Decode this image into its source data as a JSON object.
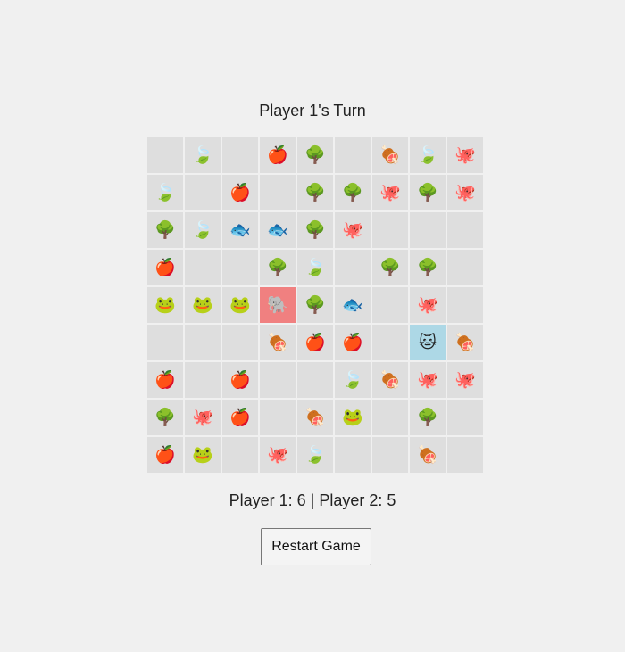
{
  "status": {
    "turn_text": "Player 1's Turn",
    "score_text": "Player 1: 6 | Player 2: 5"
  },
  "controls": {
    "restart_label": "Restart Game"
  },
  "board": {
    "cols": 9,
    "rows": 9,
    "colors": {
      "cell": "#dedede",
      "player1_selected": "#f08080",
      "player2_selected": "#add8e6"
    },
    "pieces": {
      "apple": "🍎",
      "tree": "🌳",
      "leaf": "🍃",
      "meat": "🍖",
      "octopus": "🐙",
      "fish": "🐟",
      "frog": "🐸",
      "elephant": "🐘",
      "cat": "🐱"
    },
    "selections": [
      {
        "row": 4,
        "col": 3,
        "player": 1
      },
      {
        "row": 5,
        "col": 7,
        "player": 2
      }
    ],
    "grid": [
      [
        "",
        "leaf",
        "",
        "apple",
        "tree",
        "",
        "meat",
        "leaf",
        "octopus"
      ],
      [
        "leaf",
        "",
        "apple",
        "",
        "tree",
        "tree",
        "octopus",
        "tree",
        "octopus"
      ],
      [
        "tree",
        "leaf",
        "fish",
        "fish",
        "tree",
        "octopus",
        "",
        "",
        ""
      ],
      [
        "apple",
        "",
        "",
        "tree",
        "leaf",
        "",
        "tree",
        "tree",
        ""
      ],
      [
        "frog",
        "frog",
        "frog",
        "elephant",
        "tree",
        "fish",
        "",
        "octopus",
        ""
      ],
      [
        "",
        "",
        "",
        "meat",
        "apple",
        "apple",
        "",
        "cat",
        "meat"
      ],
      [
        "apple",
        "",
        "apple",
        "",
        "",
        "leaf",
        "meat",
        "octopus",
        "octopus"
      ],
      [
        "tree",
        "octopus",
        "apple",
        "",
        "meat",
        "frog",
        "",
        "tree",
        ""
      ],
      [
        "apple",
        "frog",
        "",
        "octopus",
        "leaf",
        "",
        "",
        "meat",
        ""
      ]
    ]
  }
}
